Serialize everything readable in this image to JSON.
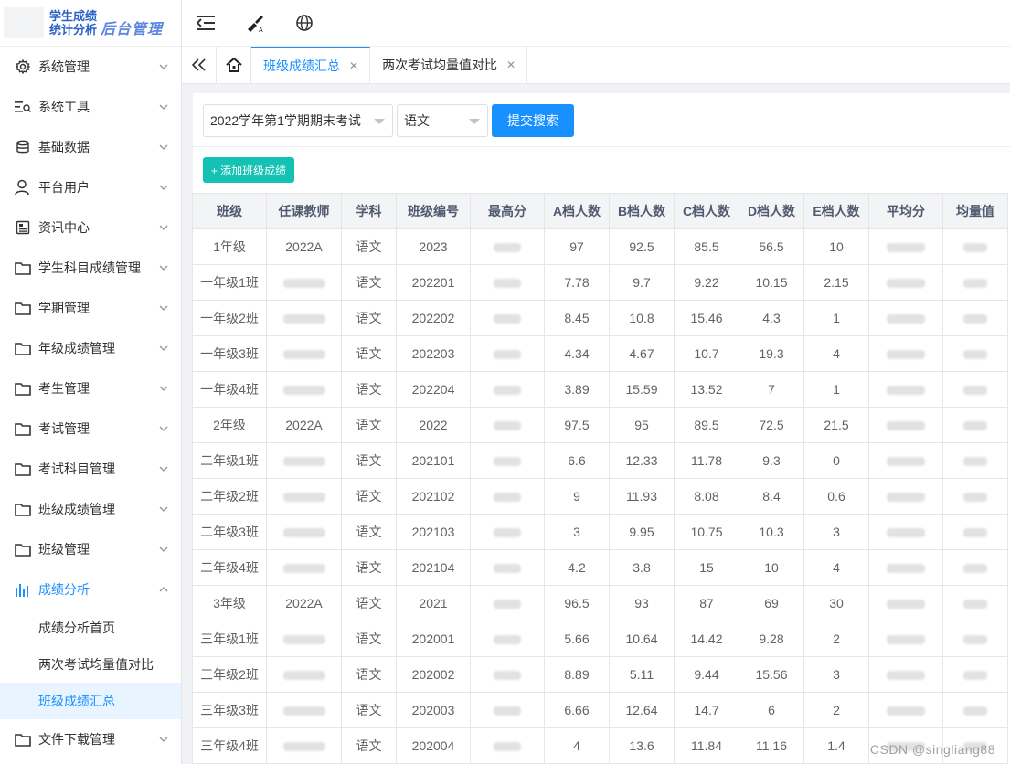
{
  "app": {
    "logo_line1": "学生成绩",
    "logo_line2": "统计分析",
    "logo_italic": "后台管理"
  },
  "topbar": {
    "icons": [
      "menu-fold-icon",
      "brush-icon",
      "globe-icon"
    ]
  },
  "sidebar": {
    "items": [
      {
        "label": "系统管理",
        "icon": "gear-icon"
      },
      {
        "label": "系统工具",
        "icon": "tools-icon"
      },
      {
        "label": "基础数据",
        "icon": "database-icon"
      },
      {
        "label": "平台用户",
        "icon": "user-icon"
      },
      {
        "label": "资讯中心",
        "icon": "news-icon"
      },
      {
        "label": "学生科目成绩管理",
        "icon": "folder-icon"
      },
      {
        "label": "学期管理",
        "icon": "folder-icon"
      },
      {
        "label": "年级成绩管理",
        "icon": "folder-icon"
      },
      {
        "label": "考生管理",
        "icon": "folder-icon"
      },
      {
        "label": "考试管理",
        "icon": "folder-icon"
      },
      {
        "label": "考试科目管理",
        "icon": "folder-icon"
      },
      {
        "label": "班级成绩管理",
        "icon": "folder-icon"
      },
      {
        "label": "班级管理",
        "icon": "folder-icon"
      },
      {
        "label": "成绩分析",
        "icon": "bar-chart-icon",
        "expanded": true
      },
      {
        "label": "文件下载管理",
        "icon": "folder-icon"
      }
    ],
    "submenu": [
      {
        "label": "成绩分析首页"
      },
      {
        "label": "两次考试均量值对比"
      },
      {
        "label": "班级成绩汇总",
        "active": true
      }
    ]
  },
  "tabs": {
    "items": [
      {
        "label": "班级成绩汇总",
        "active": true
      },
      {
        "label": "两次考试均量值对比",
        "active": false
      }
    ]
  },
  "filters": {
    "exam": "2022学年第1学期期末考试",
    "subject": "语文",
    "submit_label": "提交搜索"
  },
  "actions": {
    "add_label": "+ 添加班级成绩"
  },
  "table": {
    "headers": [
      "班级",
      "任课教师",
      "学科",
      "班级编号",
      "最高分",
      "A档人数",
      "B档人数",
      "C档人数",
      "D档人数",
      "E档人数",
      "平均分",
      "均量值"
    ],
    "rows": [
      {
        "class": "1年级",
        "teacher": "2022A",
        "subject": "语文",
        "code": "2023",
        "a": "97",
        "b": "92.5",
        "c": "85.5",
        "d": "56.5",
        "e": "10"
      },
      {
        "class": "一年级1班",
        "teacher": null,
        "subject": "语文",
        "code": "202201",
        "a": "7.78",
        "b": "9.7",
        "c": "9.22",
        "d": "10.15",
        "e": "2.15"
      },
      {
        "class": "一年级2班",
        "teacher": null,
        "subject": "语文",
        "code": "202202",
        "a": "8.45",
        "b": "10.8",
        "c": "15.46",
        "d": "4.3",
        "e": "1"
      },
      {
        "class": "一年级3班",
        "teacher": null,
        "subject": "语文",
        "code": "202203",
        "a": "4.34",
        "b": "4.67",
        "c": "10.7",
        "d": "19.3",
        "e": "4"
      },
      {
        "class": "一年级4班",
        "teacher": null,
        "subject": "语文",
        "code": "202204",
        "a": "3.89",
        "b": "15.59",
        "c": "13.52",
        "d": "7",
        "e": "1"
      },
      {
        "class": "2年级",
        "teacher": "2022A",
        "subject": "语文",
        "code": "2022",
        "a": "97.5",
        "b": "95",
        "c": "89.5",
        "d": "72.5",
        "e": "21.5"
      },
      {
        "class": "二年级1班",
        "teacher": null,
        "subject": "语文",
        "code": "202101",
        "a": "6.6",
        "b": "12.33",
        "c": "11.78",
        "d": "9.3",
        "e": "0"
      },
      {
        "class": "二年级2班",
        "teacher": null,
        "subject": "语文",
        "code": "202102",
        "a": "9",
        "b": "11.93",
        "c": "8.08",
        "d": "8.4",
        "e": "0.6"
      },
      {
        "class": "二年级3班",
        "teacher": null,
        "subject": "语文",
        "code": "202103",
        "a": "3",
        "b": "9.95",
        "c": "10.75",
        "d": "10.3",
        "e": "3"
      },
      {
        "class": "二年级4班",
        "teacher": null,
        "subject": "语文",
        "code": "202104",
        "a": "4.2",
        "b": "3.8",
        "c": "15",
        "d": "10",
        "e": "4"
      },
      {
        "class": "3年级",
        "teacher": "2022A",
        "subject": "语文",
        "code": "2021",
        "a": "96.5",
        "b": "93",
        "c": "87",
        "d": "69",
        "e": "30"
      },
      {
        "class": "三年级1班",
        "teacher": null,
        "subject": "语文",
        "code": "202001",
        "a": "5.66",
        "b": "10.64",
        "c": "14.42",
        "d": "9.28",
        "e": "2"
      },
      {
        "class": "三年级2班",
        "teacher": null,
        "subject": "语文",
        "code": "202002",
        "a": "8.89",
        "b": "5.11",
        "c": "9.44",
        "d": "15.56",
        "e": "3"
      },
      {
        "class": "三年级3班",
        "teacher": null,
        "subject": "语文",
        "code": "202003",
        "a": "6.66",
        "b": "12.64",
        "c": "14.7",
        "d": "6",
        "e": "2"
      },
      {
        "class": "三年级4班",
        "teacher": null,
        "subject": "语文",
        "code": "202004",
        "a": "4",
        "b": "13.6",
        "c": "11.84",
        "d": "11.16",
        "e": "1.4"
      }
    ]
  },
  "watermark": "CSDN @singliang88",
  "colors": {
    "accent": "#1890ff",
    "add_button": "#13c2b3",
    "active_submenu_bg": "#e8f4ff"
  }
}
